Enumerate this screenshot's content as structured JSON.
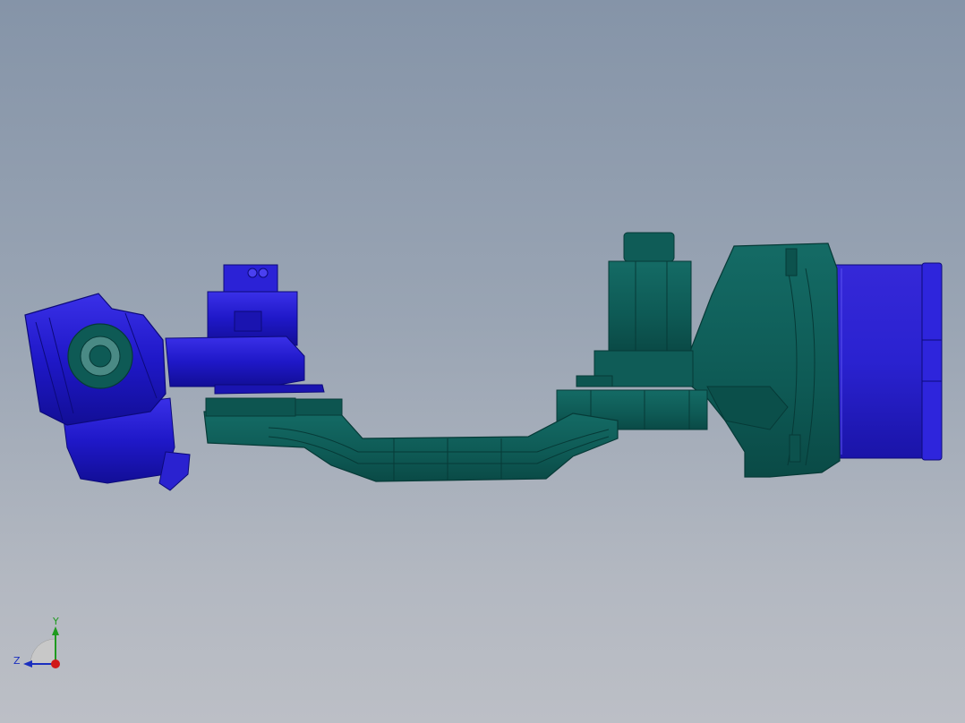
{
  "viewport": {
    "background_top": "#8594a8",
    "background_bottom": "#bcbfc6"
  },
  "model": {
    "colors": {
      "teal_body": "#0e5a55",
      "teal_edge": "#063a37",
      "blue_part": "#1f18c8",
      "blue_dark": "#0c0a7a",
      "blue_motor": "#2a22d8"
    }
  },
  "triad": {
    "y_label": "Y",
    "z_label": "Z",
    "y_color": "#1f9a1f",
    "z_color": "#1a2fbf",
    "x_color": "#d01818"
  }
}
